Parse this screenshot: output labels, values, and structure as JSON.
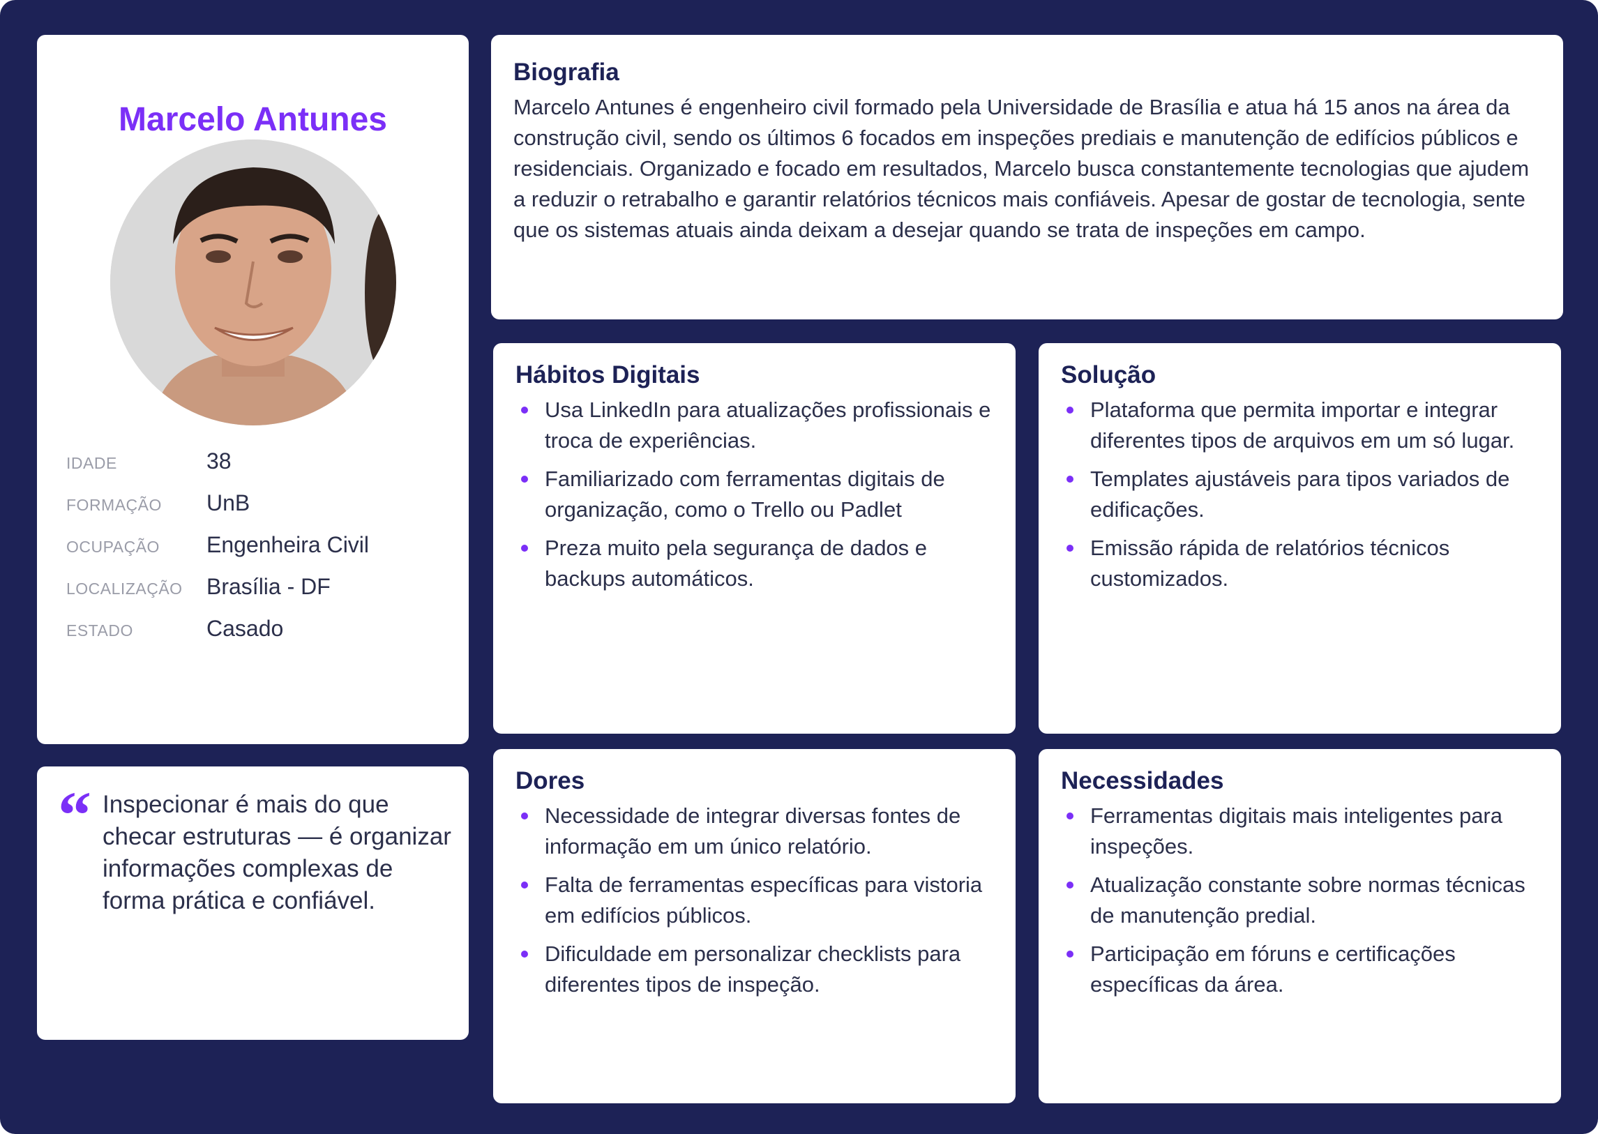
{
  "profile": {
    "name": "Marcelo Antunes",
    "info": [
      {
        "label": "IDADE",
        "value": "38"
      },
      {
        "label": "FORMAÇÃO",
        "value": "UnB"
      },
      {
        "label": "OCUPAÇÃO",
        "value": "Engenheira Civil"
      },
      {
        "label": "LOCALIZAÇÃO",
        "value": "Brasília - DF"
      },
      {
        "label": "ESTADO",
        "value": "Casado"
      }
    ]
  },
  "quote": {
    "mark": "“",
    "text": "Inspecionar é mais do que checar estruturas — é organizar informações complexas de forma prática e confiável."
  },
  "bio": {
    "title": "Biografia",
    "text": "Marcelo Antunes é engenheiro civil formado pela Universidade de Brasília e atua há 15 anos na área da construção civil, sendo os últimos 6 focados em inspeções prediais e manutenção de edifícios públicos e residenciais. Organizado e focado em resultados, Marcelo busca constantemente tecnologias que ajudem a reduzir o retrabalho e garantir relatórios técnicos mais confiáveis. Apesar de gostar de tecnologia, sente que os sistemas atuais ainda deixam a desejar quando se trata de inspeções em campo."
  },
  "habitos": {
    "title": "Hábitos Digitais",
    "items": [
      "Usa LinkedIn para atualizações profissionais e troca de experiências.",
      "Familiarizado com ferramentas digitais de organização, como o Trello ou Padlet",
      "Preza muito pela segurança de dados e backups automáticos."
    ]
  },
  "solucao": {
    "title": "Solução",
    "items": [
      "Plataforma que permita importar e integrar diferentes tipos de arquivos em um só lugar.",
      "Templates ajustáveis para tipos variados de edificações.",
      "Emissão rápida de relatórios técnicos customizados."
    ]
  },
  "dores": {
    "title": "Dores",
    "items": [
      "Necessidade de integrar diversas fontes de informação em um único relatório.",
      "Falta de ferramentas específicas para vistoria em edifícios públicos.",
      "Dificuldade em personalizar checklists para diferentes tipos de inspeção."
    ]
  },
  "necessidades": {
    "title": "Necessidades",
    "items": [
      "Ferramentas digitais mais inteligentes para inspeções.",
      "Atualização constante sobre normas técnicas de manutenção predial.",
      "Participação em fóruns e certificações específicas da área."
    ]
  },
  "colors": {
    "background": "#1d2256",
    "accent": "#7b2ff7",
    "card": "#ffffff"
  }
}
